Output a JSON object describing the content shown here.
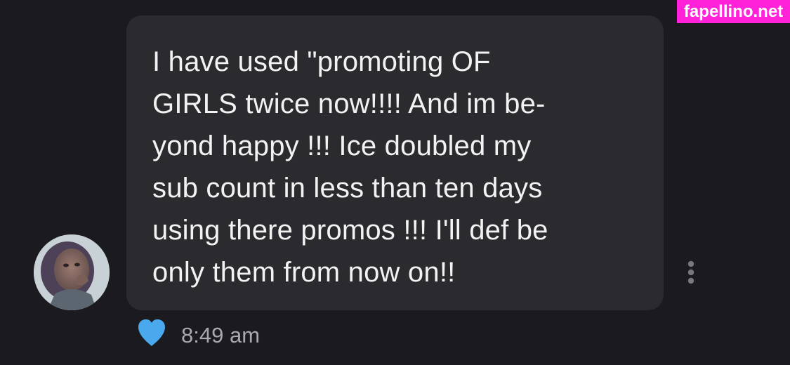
{
  "watermark": "fapellino.net",
  "message": {
    "lines": [
      "I have used \"promoting OF",
      "GIRLS twice now!!!! And im be-",
      "yond happy !!! Ice doubled my",
      "sub count in less than ten days",
      "using there promos !!! I'll def be",
      "only them from now on!!"
    ],
    "timestamp": "8:49 am",
    "reaction": "heart-icon"
  },
  "colors": {
    "background": "#1b1a1f",
    "bubble": "#2b2b2f",
    "text": "#f2f2f2",
    "timestamp": "#a9a9ad",
    "heart": "#4aa8ec",
    "watermark_bg": "#ff22d8"
  },
  "icons": {
    "more": "more-vertical-icon",
    "avatar": "avatar"
  }
}
